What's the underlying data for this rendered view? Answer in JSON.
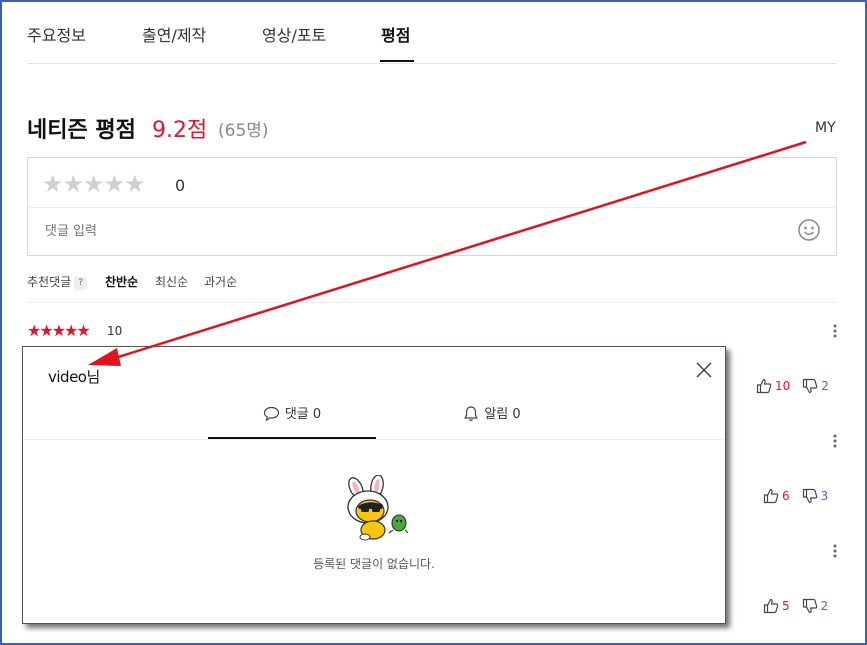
{
  "tabs": [
    {
      "label": "주요정보",
      "active": false
    },
    {
      "label": "출연/제작",
      "active": false
    },
    {
      "label": "영상/포토",
      "active": false
    },
    {
      "label": "평점",
      "active": true
    }
  ],
  "rating": {
    "title": "네티즌 평점",
    "score": "9.2점",
    "count": "(65명)",
    "my_label": "MY"
  },
  "input": {
    "star_count": "0",
    "placeholder": "댓글 입력"
  },
  "sort": {
    "recommended": "추천댓글",
    "help": "?",
    "options": [
      "찬반순",
      "최신순",
      "과거순"
    ],
    "active": "찬반순"
  },
  "reviews": [
    {
      "stars": "★★★★★",
      "score": "10",
      "likes": "10",
      "dislikes": "2"
    },
    {
      "likes": "6",
      "dislikes": "3"
    },
    {
      "likes": "5",
      "dislikes": "2"
    }
  ],
  "popup": {
    "title": "video님",
    "tabs": [
      {
        "label": "댓글 0",
        "icon": "speech-bubble-icon",
        "active": true
      },
      {
        "label": "알림 0",
        "icon": "bell-icon",
        "active": false
      }
    ],
    "empty_message": "등록된 댓글이 없습니다."
  },
  "colors": {
    "accent_red": "#e5132e",
    "dislike_blue": "#3a6fd8",
    "frame_blue": "#3a5ec8",
    "annotation_arrow": "#e0141e"
  }
}
